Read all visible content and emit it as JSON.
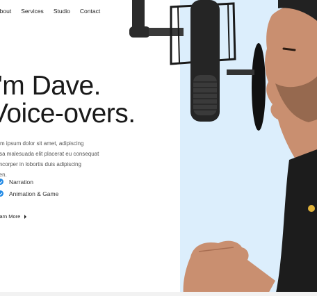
{
  "nav": {
    "items": [
      "About",
      "Services",
      "Studio",
      "Contact"
    ]
  },
  "hero": {
    "line1": "I'm Dave.",
    "line2": "Voice-overs.",
    "description": "Lorem ipsum dolor sit amet, adipiscing massa malesuada elit placerat eu consequat ullamcorper in lobortis duis adipiscing sapien.",
    "checklist": [
      "Narration",
      "Animation & Game"
    ],
    "cta_label": "Learn More"
  },
  "colors": {
    "accent": "#1e88e5",
    "hero_bg": "#dceefc"
  },
  "icons": [
    "check-circle-icon",
    "chevron-right-icon",
    "microphone-icon",
    "pop-filter-icon"
  ]
}
